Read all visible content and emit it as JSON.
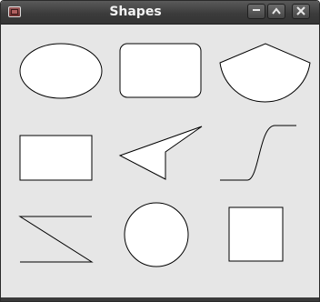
{
  "window": {
    "title": "Shapes"
  },
  "titlebar": {
    "app_icon": "window-app-icon",
    "buttons": [
      {
        "name": "minimize",
        "icon": "minimize-icon"
      },
      {
        "name": "maximize",
        "icon": "maximize-icon"
      },
      {
        "name": "close",
        "icon": "close-icon"
      }
    ]
  },
  "canvas": {
    "background": "#e6e6e6",
    "stroke": "#000000",
    "fill": "#ffffff",
    "shapes": [
      "ellipse",
      "rounded-rectangle",
      "chord",
      "rectangle",
      "polygon",
      "bezier-curve",
      "polyline",
      "circle",
      "square"
    ]
  }
}
